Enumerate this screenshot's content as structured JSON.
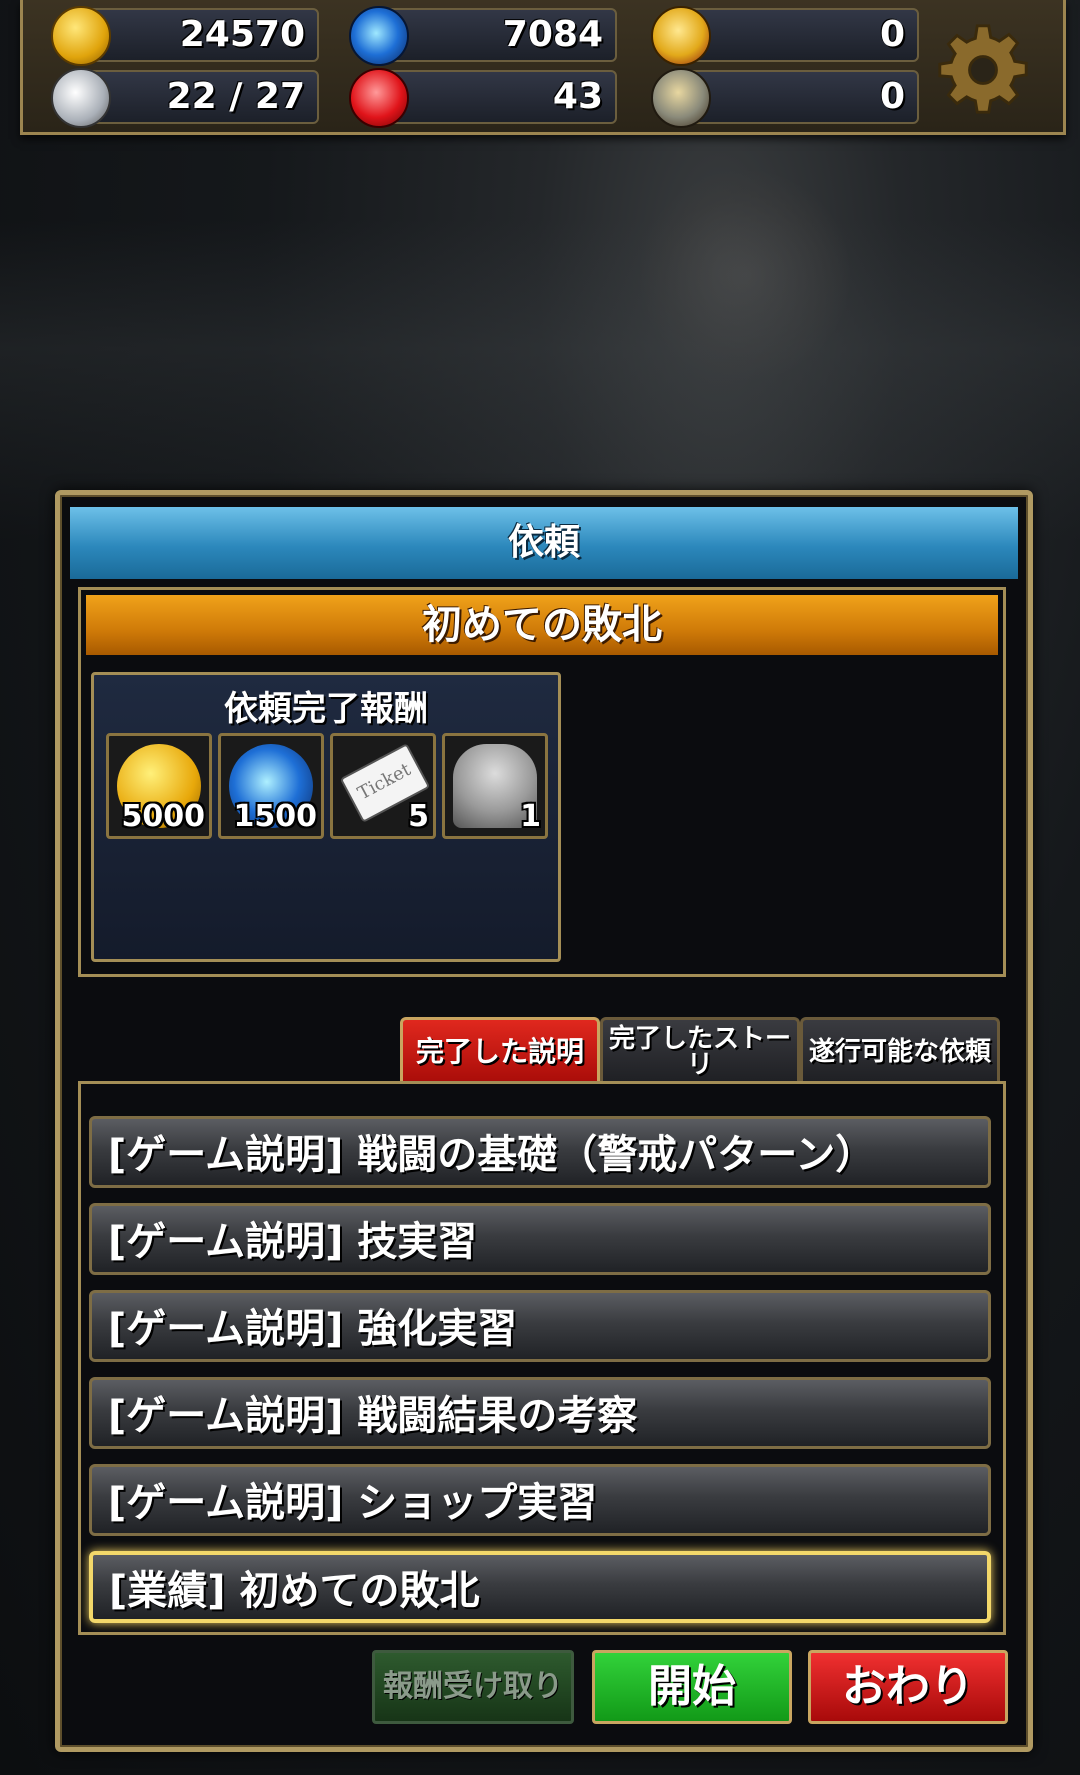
{
  "resources": [
    {
      "name": "coin",
      "icon": "coin-icon",
      "value": "24570"
    },
    {
      "name": "stamina",
      "icon": "wing-icon",
      "value": "22 / 27"
    },
    {
      "name": "orb",
      "icon": "blue-orb-icon",
      "value": "7084"
    },
    {
      "name": "ruby",
      "icon": "ruby-icon",
      "value": "43"
    },
    {
      "name": "medal",
      "icon": "medal-icon",
      "value": "0"
    },
    {
      "name": "bomb",
      "icon": "bomb-icon",
      "value": "0"
    }
  ],
  "panel": {
    "title": "依頼",
    "quest_title": "初めての敗北",
    "reward_title": "依頼完了報酬",
    "rewards": [
      {
        "icon": "coin-icon",
        "count": "5000"
      },
      {
        "icon": "blue-orb-icon",
        "count": "1500"
      },
      {
        "icon": "ticket-icon",
        "count": "5",
        "label": "Ticket"
      },
      {
        "icon": "character-silhouette-icon",
        "count": "1"
      }
    ]
  },
  "tabs": [
    {
      "label": "完了した説明",
      "active": true
    },
    {
      "label": "完了したストーリ",
      "active": false
    },
    {
      "label": "遂行可能な依頼",
      "active": false
    }
  ],
  "list": [
    {
      "label": "[ゲーム説明] 戦闘の基礎（警戒パターン）"
    },
    {
      "label": "[ゲーム説明] 技実習"
    },
    {
      "label": "[ゲーム説明] 強化実習"
    },
    {
      "label": "[ゲーム説明] 戦闘結果の考察"
    },
    {
      "label": "[ゲーム説明] ショップ実習"
    },
    {
      "label": "[業績] 初めての敗北",
      "selected": true
    }
  ],
  "buttons": {
    "claim_reward": "報酬受け取り",
    "start": "開始",
    "end": "おわり"
  },
  "colors": {
    "header_blue": "#2c88bc",
    "quest_orange": "#cf7a08",
    "gold_border": "#b09a62",
    "start_green": "#129a18",
    "end_red": "#a80a0a"
  }
}
